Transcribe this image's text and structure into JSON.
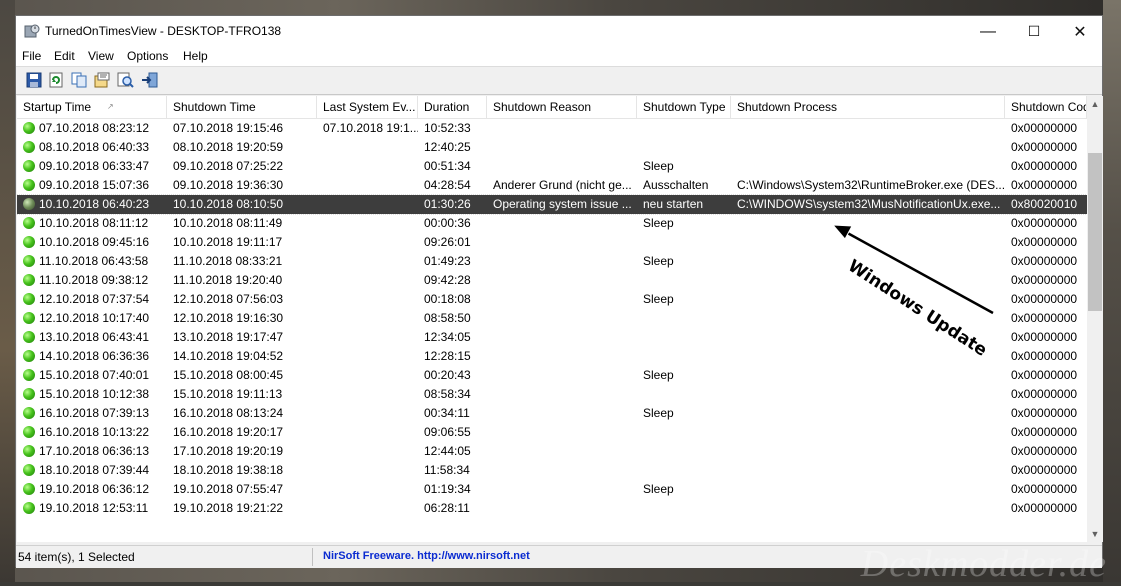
{
  "window": {
    "title": "TurnedOnTimesView  -  DESKTOP-TFRO138",
    "controls": {
      "minimize": "—",
      "maximize": "☐",
      "close": "✕"
    }
  },
  "menu": [
    "File",
    "Edit",
    "View",
    "Options",
    "Help"
  ],
  "toolbar": [
    "save-icon",
    "refresh-icon",
    "copy-icon",
    "properties-icon",
    "find-icon",
    "exit-icon"
  ],
  "columns": [
    "Startup Time",
    "Shutdown Time",
    "Last System Ev...",
    "Duration",
    "Shutdown Reason",
    "Shutdown Type",
    "Shutdown Process",
    "Shutdown Cod"
  ],
  "rows": [
    [
      "07.10.2018 08:23:12",
      "07.10.2018 19:15:46",
      "07.10.2018 19:1...",
      "10:52:33",
      "",
      "",
      "",
      "0x00000000"
    ],
    [
      "08.10.2018 06:40:33",
      "08.10.2018 19:20:59",
      "",
      "12:40:25",
      "",
      "",
      "",
      "0x00000000"
    ],
    [
      "09.10.2018 06:33:47",
      "09.10.2018 07:25:22",
      "",
      "00:51:34",
      "",
      "Sleep",
      "",
      "0x00000000"
    ],
    [
      "09.10.2018 15:07:36",
      "09.10.2018 19:36:30",
      "",
      "04:28:54",
      "Anderer Grund (nicht ge...",
      "Ausschalten",
      "C:\\Windows\\System32\\RuntimeBroker.exe (DES...",
      "0x00000000"
    ],
    [
      "10.10.2018 06:40:23",
      "10.10.2018 08:10:50",
      "",
      "01:30:26",
      "Operating system issue ...",
      "neu starten",
      "C:\\WINDOWS\\system32\\MusNotificationUx.exe...",
      "0x80020010"
    ],
    [
      "10.10.2018 08:11:12",
      "10.10.2018 08:11:49",
      "",
      "00:00:36",
      "",
      "Sleep",
      "",
      "0x00000000"
    ],
    [
      "10.10.2018 09:45:16",
      "10.10.2018 19:11:17",
      "",
      "09:26:01",
      "",
      "",
      "",
      "0x00000000"
    ],
    [
      "11.10.2018 06:43:58",
      "11.10.2018 08:33:21",
      "",
      "01:49:23",
      "",
      "Sleep",
      "",
      "0x00000000"
    ],
    [
      "11.10.2018 09:38:12",
      "11.10.2018 19:20:40",
      "",
      "09:42:28",
      "",
      "",
      "",
      "0x00000000"
    ],
    [
      "12.10.2018 07:37:54",
      "12.10.2018 07:56:03",
      "",
      "00:18:08",
      "",
      "Sleep",
      "",
      "0x00000000"
    ],
    [
      "12.10.2018 10:17:40",
      "12.10.2018 19:16:30",
      "",
      "08:58:50",
      "",
      "",
      "",
      "0x00000000"
    ],
    [
      "13.10.2018 06:43:41",
      "13.10.2018 19:17:47",
      "",
      "12:34:05",
      "",
      "",
      "",
      "0x00000000"
    ],
    [
      "14.10.2018 06:36:36",
      "14.10.2018 19:04:52",
      "",
      "12:28:15",
      "",
      "",
      "",
      "0x00000000"
    ],
    [
      "15.10.2018 07:40:01",
      "15.10.2018 08:00:45",
      "",
      "00:20:43",
      "",
      "Sleep",
      "",
      "0x00000000"
    ],
    [
      "15.10.2018 10:12:38",
      "15.10.2018 19:11:13",
      "",
      "08:58:34",
      "",
      "",
      "",
      "0x00000000"
    ],
    [
      "16.10.2018 07:39:13",
      "16.10.2018 08:13:24",
      "",
      "00:34:11",
      "",
      "Sleep",
      "",
      "0x00000000"
    ],
    [
      "16.10.2018 10:13:22",
      "16.10.2018 19:20:17",
      "",
      "09:06:55",
      "",
      "",
      "",
      "0x00000000"
    ],
    [
      "17.10.2018 06:36:13",
      "17.10.2018 19:20:19",
      "",
      "12:44:05",
      "",
      "",
      "",
      "0x00000000"
    ],
    [
      "18.10.2018 07:39:44",
      "18.10.2018 19:38:18",
      "",
      "11:58:34",
      "",
      "",
      "",
      "0x00000000"
    ],
    [
      "19.10.2018 06:36:12",
      "19.10.2018 07:55:47",
      "",
      "01:19:34",
      "",
      "Sleep",
      "",
      "0x00000000"
    ],
    [
      "19.10.2018 12:53:11",
      "19.10.2018 19:21:22",
      "",
      "06:28:11",
      "",
      "",
      "",
      "0x00000000"
    ]
  ],
  "selected_row": 4,
  "status": {
    "count": "54 item(s), 1 Selected",
    "link": "NirSoft Freeware.  http://www.nirsoft.net"
  },
  "annotation": {
    "text": "Windows Update"
  },
  "watermark": "Deskmodder.de",
  "colors": {
    "selected_bg": "#3d3d3d",
    "link": "#0a2bd1",
    "status_dot": "#46c21b"
  }
}
